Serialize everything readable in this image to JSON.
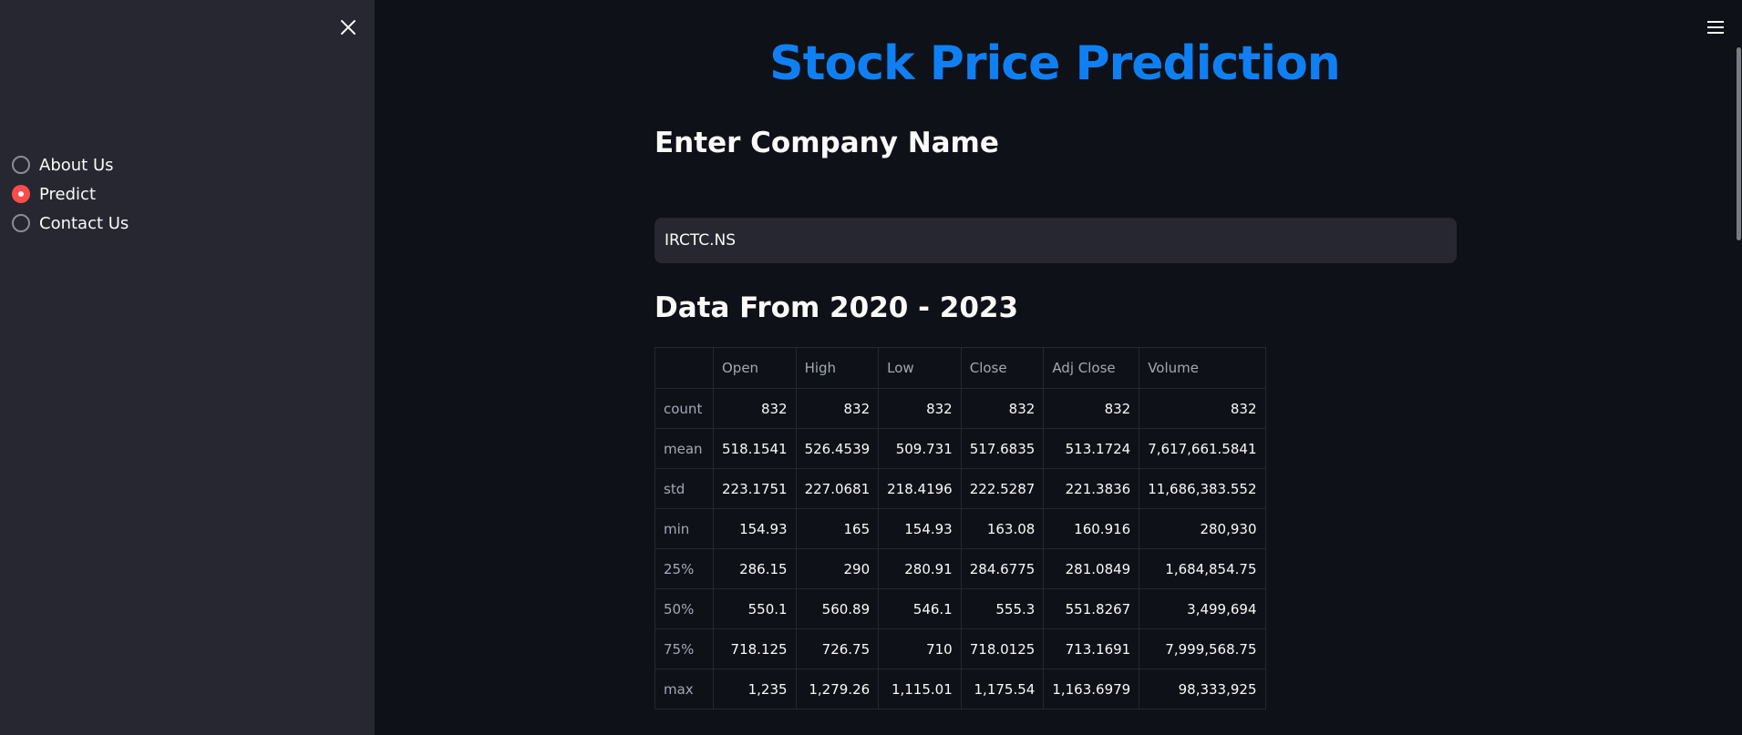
{
  "sidebar": {
    "nav_options": [
      {
        "label": "About Us",
        "selected": false
      },
      {
        "label": "Predict",
        "selected": true
      },
      {
        "label": "Contact Us",
        "selected": false
      }
    ]
  },
  "main": {
    "title": "Stock Price Prediction",
    "company_heading": "Enter Company Name",
    "company_input_value": "IRCTC.NS",
    "data_heading": "Data From 2020 - 2023"
  },
  "table": {
    "columns": [
      "",
      "Open",
      "High",
      "Low",
      "Close",
      "Adj Close",
      "Volume"
    ],
    "rows": [
      {
        "index": "count",
        "values": [
          "832",
          "832",
          "832",
          "832",
          "832",
          "832"
        ]
      },
      {
        "index": "mean",
        "values": [
          "518.1541",
          "526.4539",
          "509.731",
          "517.6835",
          "513.1724",
          "7,617,661.5841"
        ]
      },
      {
        "index": "std",
        "values": [
          "223.1751",
          "227.0681",
          "218.4196",
          "222.5287",
          "221.3836",
          "11,686,383.552"
        ]
      },
      {
        "index": "min",
        "values": [
          "154.93",
          "165",
          "154.93",
          "163.08",
          "160.916",
          "280,930"
        ]
      },
      {
        "index": "25%",
        "values": [
          "286.15",
          "290",
          "280.91",
          "284.6775",
          "281.0849",
          "1,684,854.75"
        ]
      },
      {
        "index": "50%",
        "values": [
          "550.1",
          "560.89",
          "546.1",
          "555.3",
          "551.8267",
          "3,499,694"
        ]
      },
      {
        "index": "75%",
        "values": [
          "718.125",
          "726.75",
          "710",
          "718.0125",
          "713.1691",
          "7,999,568.75"
        ]
      },
      {
        "index": "max",
        "values": [
          "1,235",
          "1,279.26",
          "1,115.01",
          "1,175.54",
          "1,163.6979",
          "98,333,925"
        ]
      }
    ]
  },
  "colors": {
    "title": "#0f80f3",
    "accent_selected": "#ff4b4b",
    "sidebar_bg": "#262730",
    "main_bg": "#0e1117"
  },
  "icons": {
    "sidebar_close": "close-icon",
    "main_menu": "hamburger-menu-icon"
  }
}
